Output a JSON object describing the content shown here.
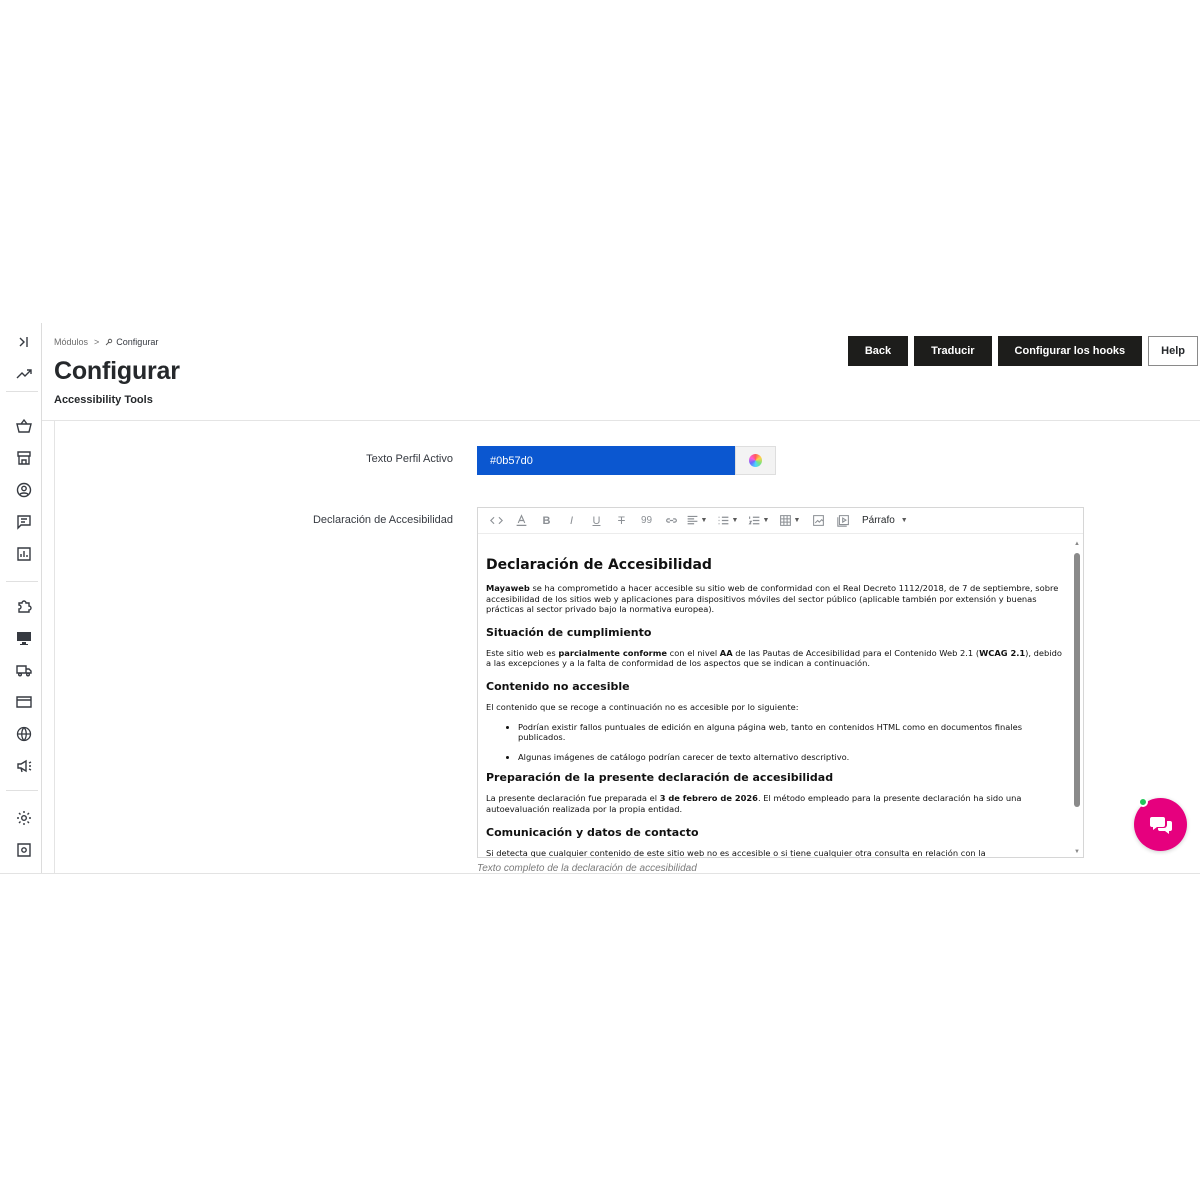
{
  "breadcrumb": {
    "parent": "Módulos",
    "separator": ">",
    "current": "Configurar"
  },
  "page": {
    "title": "Configurar",
    "subtitle": "Accessibility Tools"
  },
  "toolbar": {
    "back": "Back",
    "translate": "Traducir",
    "hooks": "Configurar los hooks",
    "help": "Help"
  },
  "sidebar": {
    "items": [
      {
        "icon": "collapse-sidebar-icon"
      },
      {
        "icon": "trending-up-icon"
      },
      {
        "icon": "basket-icon"
      },
      {
        "icon": "store-icon"
      },
      {
        "icon": "customer-icon"
      },
      {
        "icon": "messages-icon"
      },
      {
        "icon": "stats-icon"
      },
      {
        "icon": "puzzle-icon"
      },
      {
        "icon": "monitor-icon"
      },
      {
        "icon": "truck-icon"
      },
      {
        "icon": "credit-card-icon"
      },
      {
        "icon": "globe-icon"
      },
      {
        "icon": "megaphone-icon"
      },
      {
        "icon": "gear-icon"
      },
      {
        "icon": "settings-box-icon"
      }
    ]
  },
  "form": {
    "profile_color_label": "Texto Perfil Activo",
    "profile_color_value": "#0b57d0",
    "statement_label": "Declaración de Accesibilidad",
    "statement_help": "Texto completo de la declaración de accesibilidad"
  },
  "editor": {
    "format_label": "Párrafo",
    "heading": "Declaración de Accesibilidad",
    "p1_bold": "Mayaweb",
    "p1_rest": " se ha comprometido a hacer accesible su sitio web de conformidad con el Real Decreto 1112/2018, de 7 de septiembre, sobre accesibilidad de los sitios web y aplicaciones para dispositivos móviles del sector público (aplicable también por extensión y buenas prácticas al sector privado bajo la normativa europea).",
    "h_compliance": "Situación de cumplimiento",
    "p2_a": "Este sitio web es ",
    "p2_b": "parcialmente conforme",
    "p2_c": " con el nivel ",
    "p2_d": "AA",
    "p2_e": " de las Pautas de Accesibilidad para el Contenido Web 2.1 (",
    "p2_f": "WCAG 2.1",
    "p2_g": "), debido a las excepciones y a la falta de conformidad de los aspectos que se indican a continuación.",
    "h_nonaccessible": "Contenido no accesible",
    "p3": "El contenido que se recoge a continuación no es accesible por lo siguiente:",
    "list": [
      "Podrían existir fallos puntuales de edición en alguna página web, tanto en contenidos HTML como en documentos finales publicados.",
      "Algunas imágenes de catálogo podrían carecer de texto alternativo descriptivo."
    ],
    "h_preparation": "Preparación de la presente declaración de accesibilidad",
    "p4_a": "La presente declaración fue preparada el ",
    "p4_b": "3 de febrero de 2026",
    "p4_c": ". El método empleado para la presente declaración ha sido una autoevaluación realizada por la propia entidad.",
    "h_contact": "Comunicación y datos de contacto",
    "p5": "Si detecta que cualquier contenido de este sitio web no es accesible o si tiene cualquier otra consulta en relación con la"
  },
  "colors": {
    "accent": "#0b57d0",
    "button_dark": "#1d1d1b",
    "chat": "#e6007e",
    "online": "#21c65a"
  }
}
